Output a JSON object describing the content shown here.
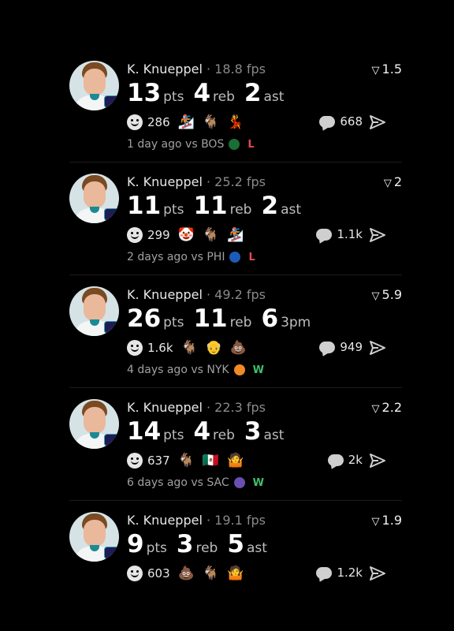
{
  "posts": [
    {
      "player": "K. Knueppel",
      "sep": "·",
      "fps": "18.8 fps",
      "metric": "1.5",
      "stats": [
        {
          "n": "13",
          "u": "pts"
        },
        {
          "n": "4",
          "u": "reb"
        },
        {
          "n": "2",
          "u": "ast"
        }
      ],
      "react_count": "286",
      "emojis": [
        "🏂",
        "🐐",
        "💃"
      ],
      "comments": "668",
      "time": "1 day ago vs BOS",
      "opp_icon": "☘",
      "opp_color": "#1b6e35",
      "result": "L",
      "result_color": "#e5484d"
    },
    {
      "player": "K. Knueppel",
      "sep": "·",
      "fps": "25.2 fps",
      "metric": "2",
      "stats": [
        {
          "n": "11",
          "u": "pts"
        },
        {
          "n": "11",
          "u": "reb"
        },
        {
          "n": "2",
          "u": "ast"
        }
      ],
      "react_count": "299",
      "emojis": [
        "🤡",
        "🐐",
        "🏂"
      ],
      "comments": "1.1k",
      "time": "2 days ago vs PHI",
      "opp_icon": "76",
      "opp_color": "#1d5bb8",
      "result": "L",
      "result_color": "#e5484d"
    },
    {
      "player": "K. Knueppel",
      "sep": "·",
      "fps": "49.2 fps",
      "metric": "5.9",
      "stats": [
        {
          "n": "26",
          "u": "pts"
        },
        {
          "n": "11",
          "u": "reb"
        },
        {
          "n": "6",
          "u": "3pm"
        }
      ],
      "react_count": "1.6k",
      "emojis": [
        "🐐",
        "👴",
        "💩"
      ],
      "comments": "949",
      "time": "4 days ago vs NYK",
      "opp_icon": "🏀",
      "opp_color": "#f08a24",
      "result": "W",
      "result_color": "#3fbf6a"
    },
    {
      "player": "K. Knueppel",
      "sep": "·",
      "fps": "22.3 fps",
      "metric": "2.2",
      "stats": [
        {
          "n": "14",
          "u": "pts"
        },
        {
          "n": "4",
          "u": "reb"
        },
        {
          "n": "3",
          "u": "ast"
        }
      ],
      "react_count": "637",
      "emojis": [
        "🐐",
        "🇲🇽",
        "🤷"
      ],
      "comments": "2k",
      "time": "6 days ago vs SAC",
      "opp_icon": "♛",
      "opp_color": "#6a4fb0",
      "result": "W",
      "result_color": "#3fbf6a"
    },
    {
      "player": "K. Knueppel",
      "sep": "·",
      "fps": "19.1 fps",
      "metric": "1.9",
      "stats": [
        {
          "n": "9",
          "u": "pts"
        },
        {
          "n": "3",
          "u": "reb"
        },
        {
          "n": "5",
          "u": "ast"
        }
      ],
      "react_count": "603",
      "emojis": [
        "💩",
        "🐐",
        "🤷"
      ],
      "comments": "1.2k",
      "time": "",
      "opp_icon": "",
      "opp_color": "",
      "result": "",
      "result_color": ""
    }
  ]
}
